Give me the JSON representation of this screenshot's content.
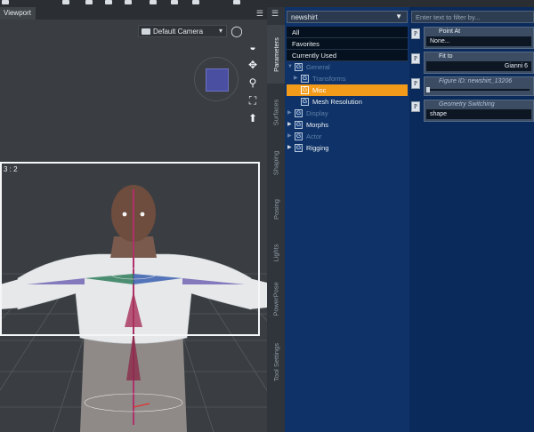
{
  "viewport": {
    "tab_label": "Viewport",
    "camera": "Default Camera",
    "frame_label": "3 : 2"
  },
  "side_tabs": [
    "Parameters",
    "Surfaces",
    "Shaping",
    "Posing",
    "Lights",
    "PowerPose",
    "Tool Settings"
  ],
  "tree": {
    "node_select": "newshirt",
    "items": [
      {
        "label": "All"
      },
      {
        "label": "Favorites"
      },
      {
        "label": "Currently Used"
      },
      {
        "label": "General"
      },
      {
        "label": "Transforms"
      },
      {
        "label": "Misc"
      },
      {
        "label": "Mesh Resolution"
      },
      {
        "label": "Display"
      },
      {
        "label": "Morphs"
      },
      {
        "label": "Actor"
      },
      {
        "label": "Rigging"
      }
    ],
    "group_icon": "G"
  },
  "props": {
    "filter_placeholder": "Enter text to filter by...",
    "p_icon": "P",
    "rows": [
      {
        "title": "Point At",
        "value": "None..."
      },
      {
        "title": "Fit to",
        "value": "Gianni 6"
      },
      {
        "title": "Figure ID: newshirt_13206",
        "value": ""
      },
      {
        "title": "Geometry Switching",
        "value": "shape"
      }
    ]
  },
  "colors": {
    "tree_bg": "#0f3368",
    "props_bg": "#0a2a5b",
    "selected": "#f29a19",
    "viewport_bg": "#3a3e42"
  },
  "icons": [
    "camera-icon",
    "sphere-view-icon",
    "orbit-icon",
    "pan-icon",
    "zoom-icon",
    "frame-icon",
    "reset-icon",
    "menu-icon",
    "dropdown-caret-icon",
    "expand-arrow-icon",
    "group-icon",
    "parameter-icon"
  ]
}
